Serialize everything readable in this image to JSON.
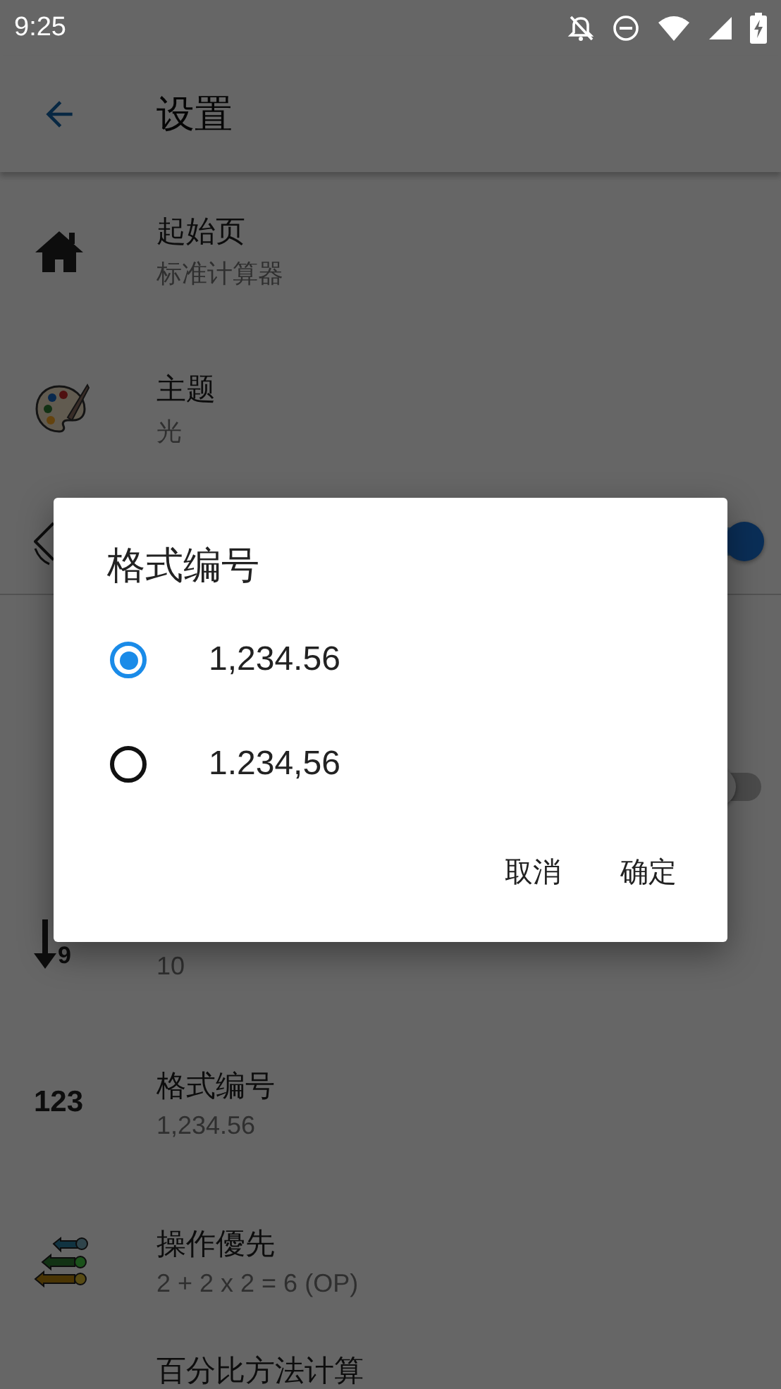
{
  "status_bar": {
    "time": "9:25"
  },
  "toolbar": {
    "title": "设置"
  },
  "settings": [
    {
      "kind": "item",
      "title": "起始页",
      "subtitle": "标准计算器"
    },
    {
      "kind": "item",
      "title": "主题",
      "subtitle": "光"
    },
    {
      "kind": "switch",
      "on": true
    },
    {
      "kind": "divider"
    },
    {
      "kind": "switch",
      "on": false
    },
    {
      "kind": "item",
      "icon_text": "9",
      "subtitle": "10"
    },
    {
      "kind": "item",
      "icon_text": "123",
      "title": "格式编号",
      "subtitle": "1,234.56"
    },
    {
      "kind": "item",
      "title": "操作優先",
      "subtitle": "2 + 2 x 2 = 6 (OP)"
    },
    {
      "kind": "last",
      "title": "百分比方法计算"
    }
  ],
  "dialog": {
    "title": "格式编号",
    "options": [
      {
        "label": "1,234.56",
        "selected": true
      },
      {
        "label": "1.234,56",
        "selected": false
      }
    ],
    "buttons": [
      "取消",
      "确定"
    ]
  }
}
